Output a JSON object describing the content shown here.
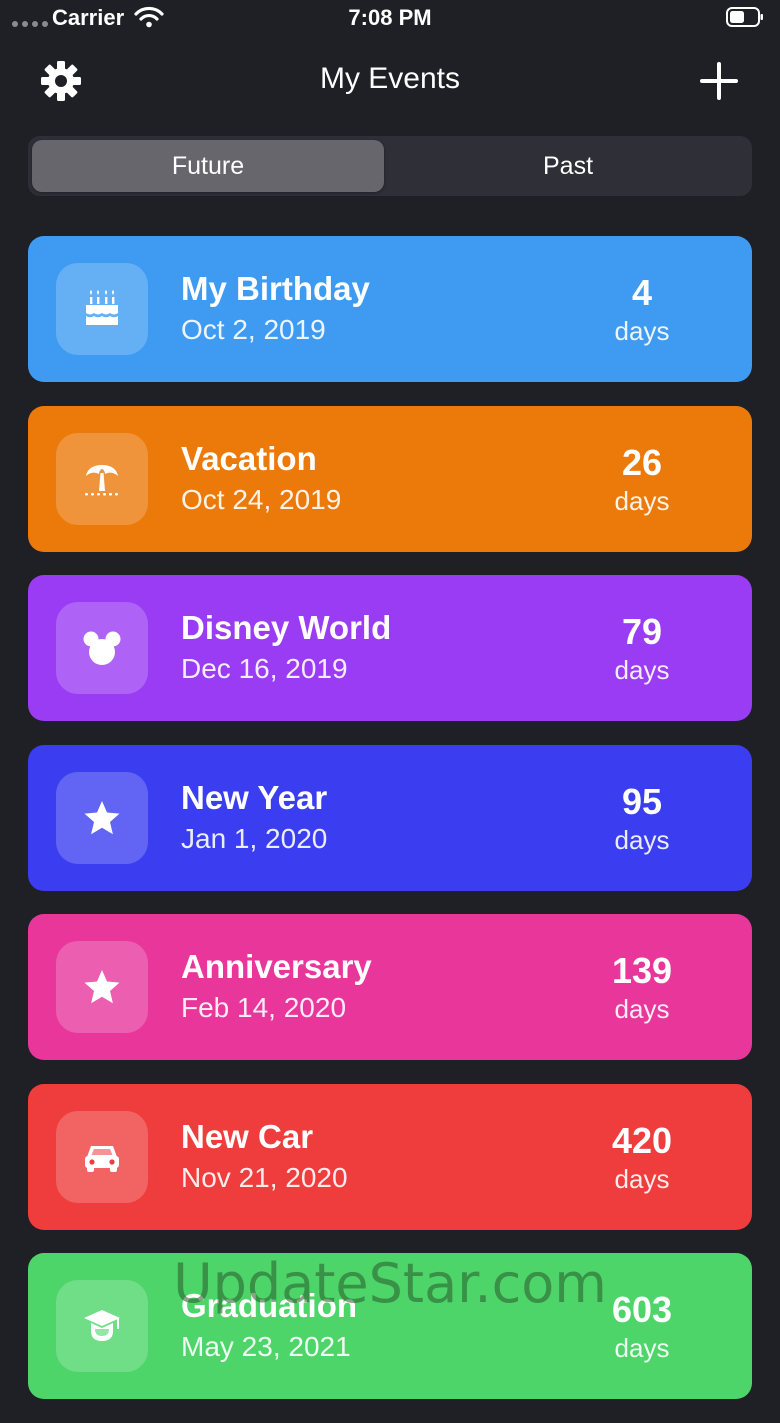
{
  "status_bar": {
    "carrier": "Carrier",
    "time": "7:08 PM"
  },
  "nav": {
    "title": "My Events"
  },
  "tabs": [
    {
      "label": "Future",
      "selected": true
    },
    {
      "label": "Past",
      "selected": false
    }
  ],
  "events": [
    {
      "name": "My Birthday",
      "date": "Oct 2, 2019",
      "count": "4",
      "unit": "days",
      "color": "#3f9bf2",
      "icon": "birthday-cake-icon"
    },
    {
      "name": "Vacation",
      "date": "Oct 24, 2019",
      "count": "26",
      "unit": "days",
      "color": "#ec7a0b",
      "icon": "palm-tree-icon"
    },
    {
      "name": "Disney World",
      "date": "Dec 16, 2019",
      "count": "79",
      "unit": "days",
      "color": "#9a3cf4",
      "icon": "mouse-ears-icon"
    },
    {
      "name": "New Year",
      "date": "Jan 1, 2020",
      "count": "95",
      "unit": "days",
      "color": "#3b3ef0",
      "icon": "star-icon"
    },
    {
      "name": "Anniversary",
      "date": "Feb 14, 2020",
      "count": "139",
      "unit": "days",
      "color": "#e8369b",
      "icon": "star-icon"
    },
    {
      "name": "New Car",
      "date": "Nov 21, 2020",
      "count": "420",
      "unit": "days",
      "color": "#ef3c3c",
      "icon": "car-icon"
    },
    {
      "name": "Graduation",
      "date": "May 23, 2021",
      "count": "603",
      "unit": "days",
      "color": "#4dd56a",
      "icon": "graduation-cap-icon"
    }
  ],
  "watermark": "UpdateStar.com"
}
